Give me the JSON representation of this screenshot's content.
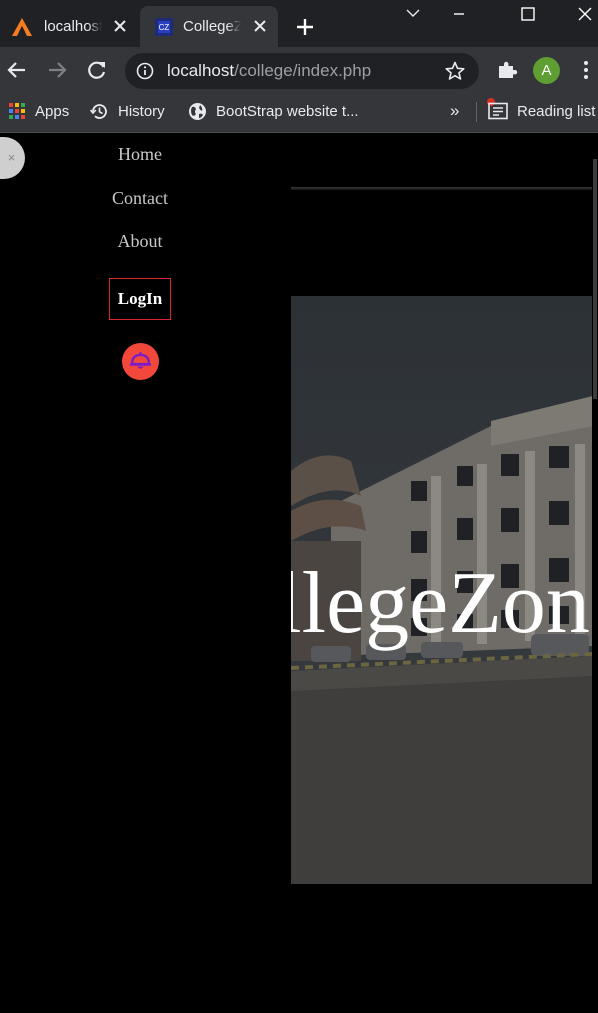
{
  "browser": {
    "tabs": [
      {
        "title": "localhost",
        "favicon": "xampp-icon",
        "active": false
      },
      {
        "title": "CollegeZone",
        "favicon": "cz-icon",
        "active": true
      }
    ],
    "address": {
      "host": "localhost",
      "path": "/college/index.php"
    },
    "profile_initial": "A",
    "bookmarks": [
      {
        "label": "Apps",
        "icon": "apps-grid-icon"
      },
      {
        "label": "History",
        "icon": "history-icon"
      },
      {
        "label": "BootStrap website t...",
        "icon": "globe-icon"
      }
    ],
    "bookmarks_overflow": "»",
    "reading_list": "Reading list"
  },
  "sidenav": {
    "close_label": "×",
    "links": [
      "Home",
      "Contact",
      "About"
    ],
    "login_label": "LogIn",
    "accent_color": "#d9252c",
    "bell_color": "#f2483b"
  },
  "hero": {
    "title": "CollegeZone"
  }
}
